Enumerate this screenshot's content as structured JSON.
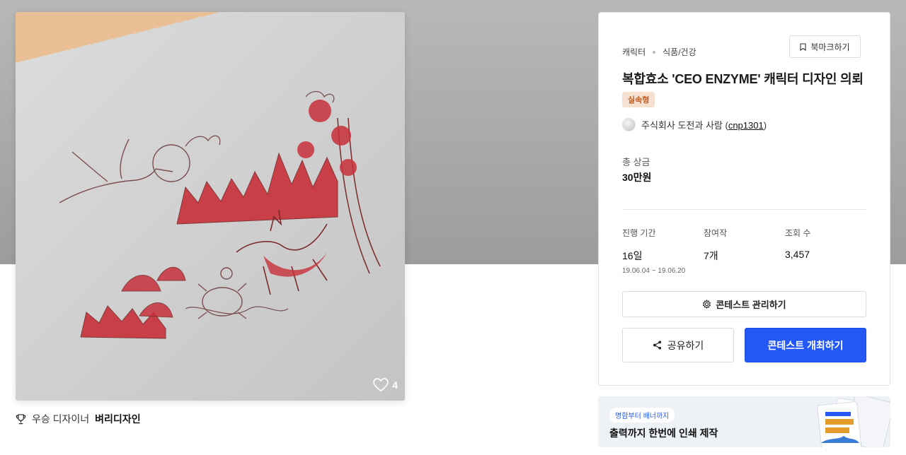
{
  "artwork": {
    "like_count": "4"
  },
  "best_designer": {
    "label": "우승 디자이너",
    "name": "벼리디자인"
  },
  "contest": {
    "category_main": "캐릭터",
    "category_sub": "식품/건강",
    "bookmark_label": "북마크하기",
    "title": "복합효소 'CEO ENZYME' 캐릭터 디자인 의뢰",
    "badge": "실속형",
    "owner_name": "주식회사 도전과 사람 (",
    "owner_id": "cnp1301",
    "owner_close": ")",
    "prize_label": "총 상금",
    "prize_value": "30만원",
    "stats": {
      "period_label": "진행 기간",
      "period_value": "16일",
      "period_range": "19.06.04 ~ 19.06.20",
      "participants_label": "참여작",
      "participants_value": "7개",
      "views_label": "조회 수",
      "views_value": "3,457"
    },
    "manage_label": "콘테스트 관리하기",
    "share_label": "공유하기",
    "host_label": "콘테스트 개최하기"
  },
  "banner": {
    "pill": "명함부터 배너까지",
    "headline": "출력까지 한번에 인쇄 제작"
  },
  "colors": {
    "accent": "#2458f5",
    "badge_bg": "#f6e1d0",
    "badge_text": "#c25a1e",
    "ink_red": "#c8303a"
  },
  "icons": [
    "heart-icon",
    "trophy-icon",
    "bookmark-icon",
    "gear-icon",
    "share-icon"
  ]
}
